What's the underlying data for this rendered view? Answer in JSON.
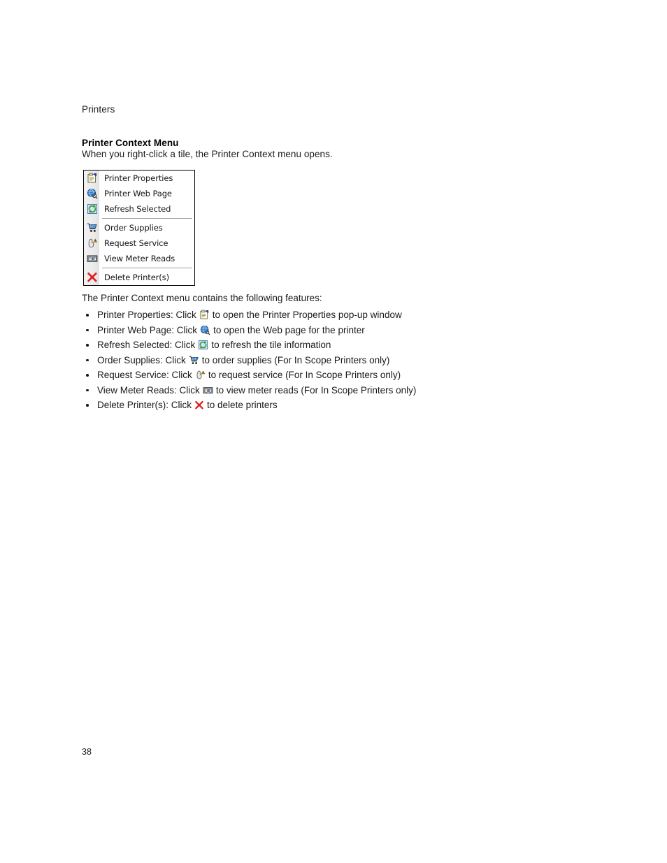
{
  "document": {
    "running_header": "Printers",
    "section_heading": "Printer Context Menu",
    "section_intro": "When you right-click a tile, the Printer Context menu opens.",
    "lead_line": "The Printer Context menu contains the following features:",
    "page_number": "38"
  },
  "context_menu": {
    "groups": [
      {
        "items": [
          {
            "label": "Printer Properties",
            "icon": "printer-properties-icon"
          },
          {
            "label": "Printer Web Page",
            "icon": "printer-web-page-icon"
          },
          {
            "label": "Refresh Selected",
            "icon": "refresh-selected-icon"
          }
        ]
      },
      {
        "items": [
          {
            "label": "Order Supplies",
            "icon": "order-supplies-icon"
          },
          {
            "label": "Request Service",
            "icon": "request-service-icon"
          },
          {
            "label": "View Meter Reads",
            "icon": "view-meter-reads-icon"
          }
        ]
      },
      {
        "items": [
          {
            "label": "Delete Printer(s)",
            "icon": "delete-printers-icon"
          }
        ]
      }
    ]
  },
  "features": [
    {
      "before": "Printer Properties: Click",
      "icon": "printer-properties-icon",
      "after": "to open the Printer Properties pop-up window"
    },
    {
      "before": "Printer Web Page: Click",
      "icon": "printer-web-page-icon",
      "after": "to open the Web page for the printer"
    },
    {
      "before": "Refresh Selected: Click",
      "icon": "refresh-selected-icon",
      "after": "to refresh the tile information"
    },
    {
      "before": "Order Supplies: Click",
      "icon": "order-supplies-icon",
      "after": "to order supplies (For In Scope Printers only)"
    },
    {
      "before": "Request Service: Click",
      "icon": "request-service-icon",
      "after": "to request service (For In Scope Printers only)"
    },
    {
      "before": "View Meter Reads: Click",
      "icon": "view-meter-reads-icon",
      "after": "to view meter reads (For In Scope Printers only)"
    },
    {
      "before": "Delete Printer(s): Click",
      "icon": "delete-printers-icon",
      "after": "to delete printers"
    }
  ],
  "colors": {
    "menu_border": "#000000",
    "menu_gutter": "#ececec",
    "separator": "#9a9a9a",
    "text": "#1a1a1a",
    "delete_x": "#e01b1b",
    "globe_blue": "#1c62b4",
    "refresh_green": "#3a9a30",
    "warning_yellow": "#f2c020"
  }
}
